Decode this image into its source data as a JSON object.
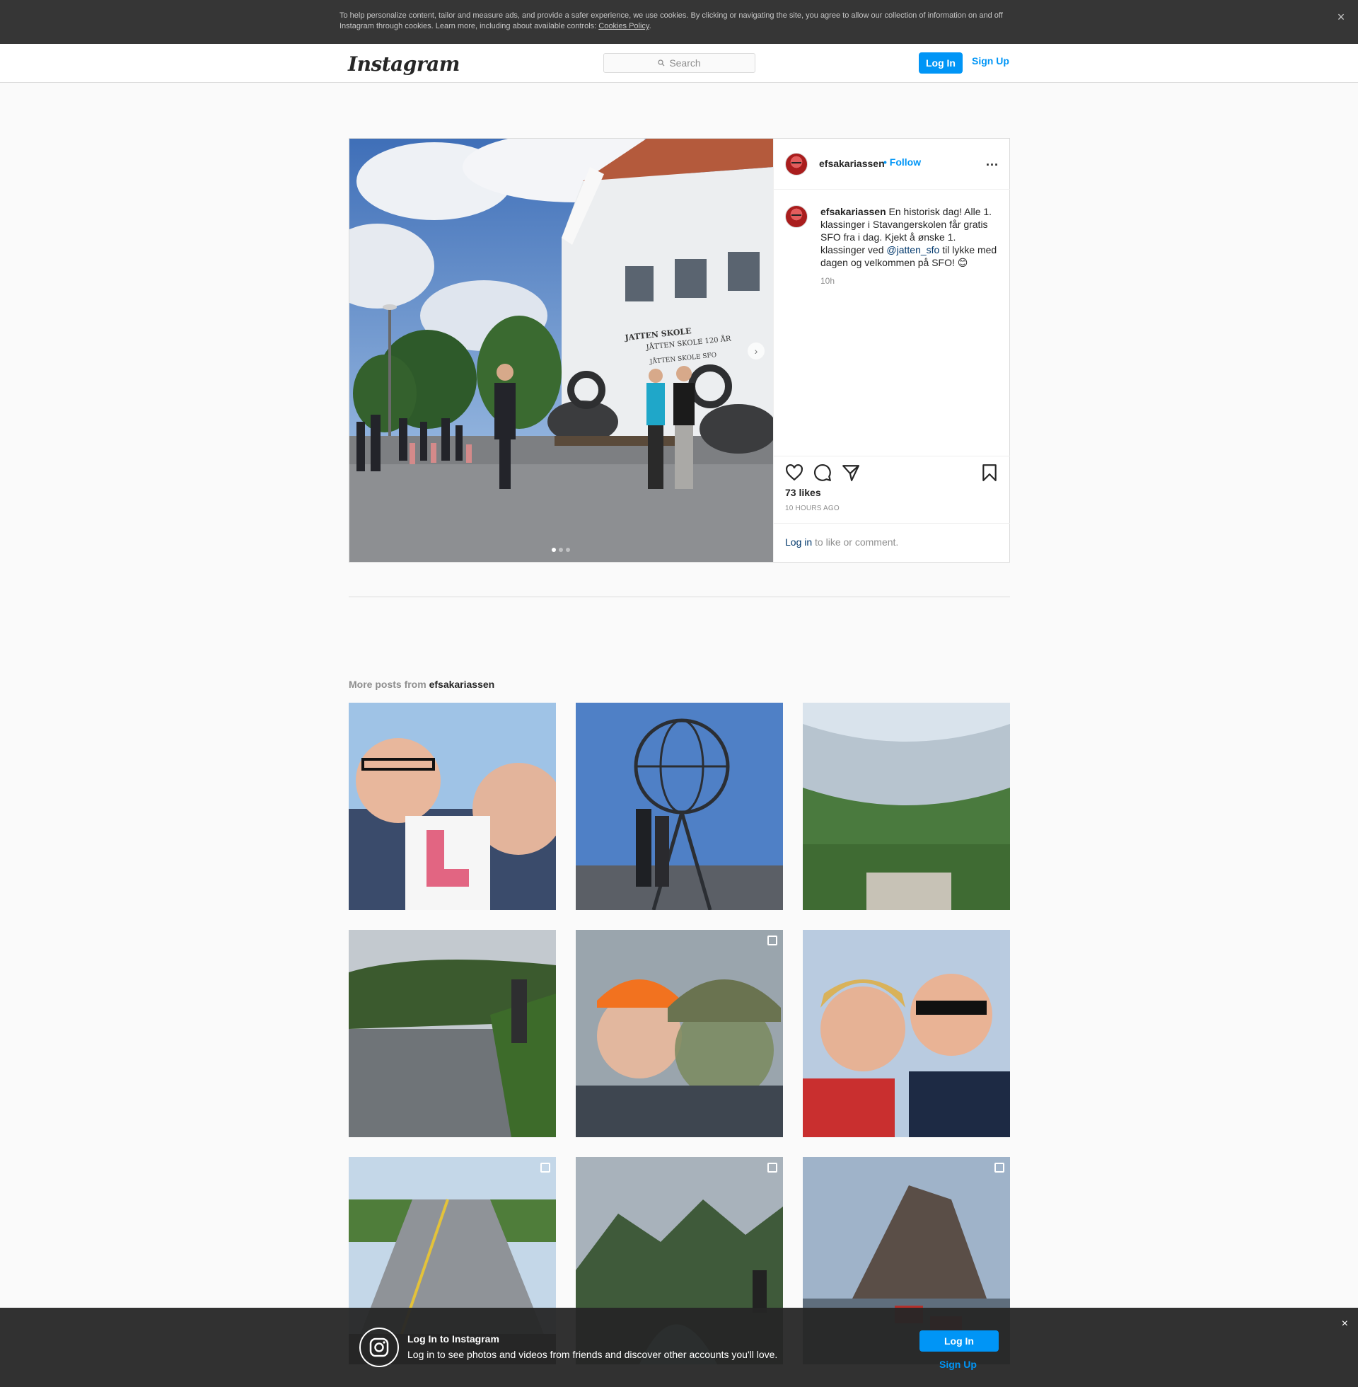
{
  "cookie_banner": {
    "text": "To help personalize content, tailor and measure ads, and provide a safer experience, we use cookies. By clicking or navigating the site, you agree to allow our collection of information on and off Instagram through cookies. Learn more, including about available controls: ",
    "link": "Cookies Policy",
    "trailing": ".",
    "close": "×"
  },
  "header": {
    "logo": "Instagram",
    "search_placeholder": "Search",
    "login": "Log In",
    "signup": "Sign Up"
  },
  "post": {
    "username": "efsakariassen",
    "follow": "• Follow",
    "more": "...",
    "caption_user": "efsakariassen",
    "caption_before_mention": " En historisk dag! Alle 1. klassinger i Stavangerskolen får gratis SFO fra i dag. Kjekt å ønske 1. klassinger ved ",
    "caption_mention": "@jatten_sfo",
    "caption_after_mention": " til lykke med dagen og velkommen på SFO! 😊",
    "caption_time": "10h",
    "likes": "73 likes",
    "time_ago": "10 HOURS AGO",
    "login_link": "Log in",
    "login_suffix": " to like or comment.",
    "photo_sign_lines": [
      "JATTEN SKOLE",
      "JÅTTEN SKOLE 120 ÅR",
      "JÅTTEN SKOLE SFO"
    ],
    "carousel_slides": 3,
    "carousel_active": 0
  },
  "more_posts": {
    "prefix": "More posts from ",
    "username": "efsakariassen"
  },
  "bottom_bar": {
    "title": "Log In to Instagram",
    "subtitle": "Log in to see photos and videos from friends and discover other accounts you'll love.",
    "login": "Log In",
    "signup": "Sign Up",
    "close": "×"
  },
  "colors": {
    "accent": "#0095f6",
    "mention": "#00376b",
    "muted": "#8e8e8e"
  }
}
